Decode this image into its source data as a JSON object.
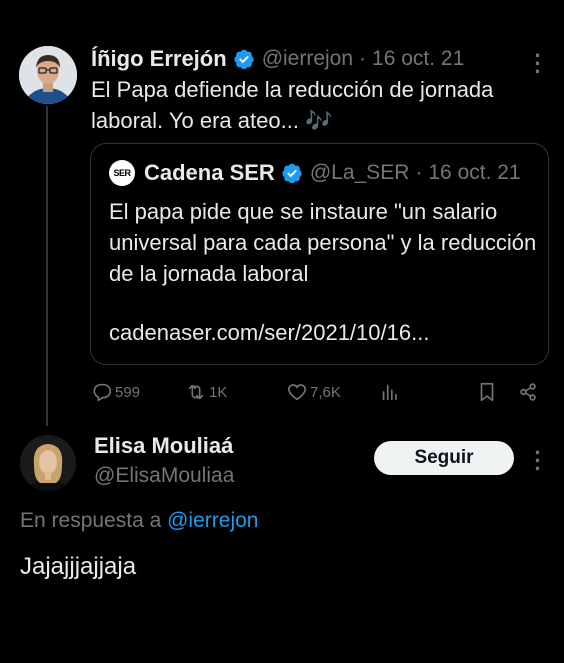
{
  "colors": {
    "background": "#000000",
    "text_primary": "#e7e9ea",
    "text_secondary": "#71767b",
    "accent_blue": "#1d9bf0",
    "border": "#2f3336"
  },
  "tweet": {
    "author_name": "Íñigo Errejón",
    "verified": true,
    "handle": "@ierrejon",
    "separator": "·",
    "date": "16 oct. 21",
    "text": "El Papa defiende la reducción de jornada laboral. Yo era ateo... 🎶",
    "avatar_icon": "avatar-photo"
  },
  "quote": {
    "logo_text": "SER",
    "author_name": "Cadena SER",
    "verified": true,
    "handle": "@La_SER",
    "separator": "·",
    "date": "16 oct. 21",
    "text": "El papa pide que se instaure \"un salario universal para cada persona\" y la reducción de la jornada laboral",
    "link": "cadenaser.com/ser/2021/10/16..."
  },
  "actions": {
    "replies": "599",
    "retweets": "1K",
    "likes": "7,6K",
    "icons": [
      "reply-icon",
      "retweet-icon",
      "like-icon",
      "views-icon",
      "bookmark-icon",
      "share-icon"
    ]
  },
  "reply": {
    "author_name": "Elisa Mouliaá",
    "handle": "@ElisaMouliaa",
    "follow_label": "Seguir",
    "in_reply_prefix": "En respuesta a",
    "in_reply_mention": "@ierrejon",
    "text": "Jajajjjajjaja"
  }
}
